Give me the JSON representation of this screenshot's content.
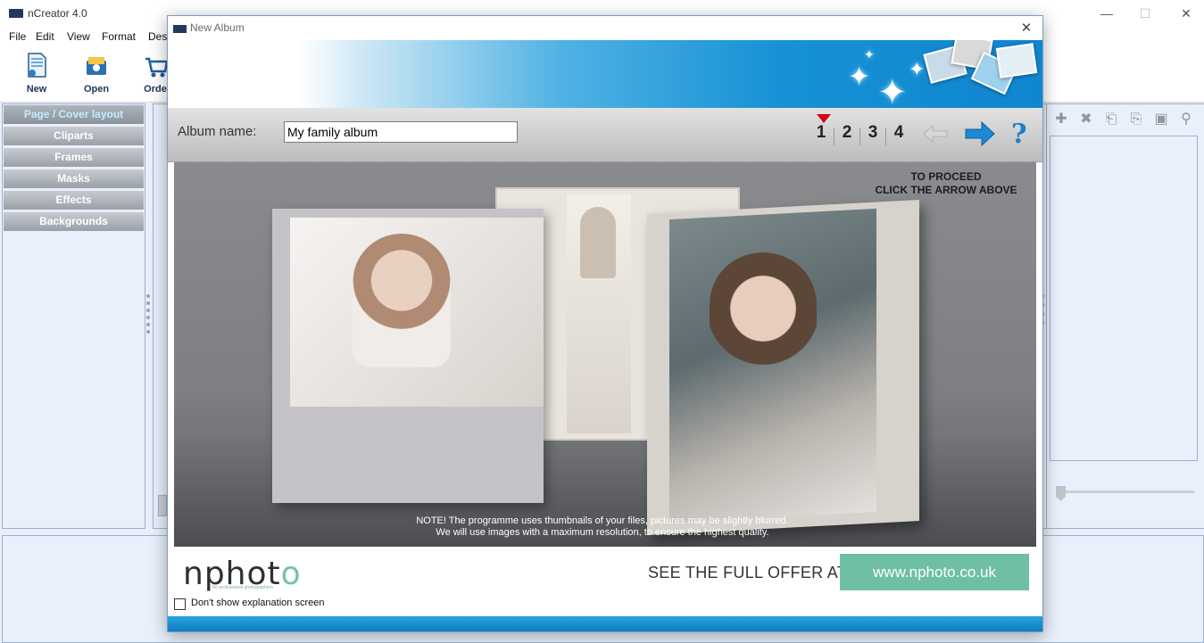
{
  "app": {
    "title": "nCreator 4.0",
    "menu": [
      "File",
      "Edit",
      "View",
      "Format",
      "Desi"
    ],
    "toolbar": [
      {
        "label": "New",
        "icon": "new-document-icon"
      },
      {
        "label": "Open",
        "icon": "open-folder-icon"
      },
      {
        "label": "Orde",
        "icon": "shopping-cart-icon"
      }
    ],
    "window_controls": {
      "minimize": "—",
      "maximize": "☐",
      "close": "✕"
    }
  },
  "left_panel": {
    "tabs": [
      "Page / Cover layout",
      "Cliparts",
      "Frames",
      "Masks",
      "Effects",
      "Backgrounds"
    ],
    "active_tab": "Page / Cover layout"
  },
  "right_panel": {
    "icons": [
      "add-icon",
      "delete-icon",
      "import-icon",
      "export-icon",
      "camera-icon",
      "stamp-icon"
    ]
  },
  "dialog": {
    "title": "New Album",
    "close": "✕",
    "album_name_label": "Album name:",
    "album_name_value": "My family album",
    "steps": [
      "1",
      "2",
      "3",
      "4"
    ],
    "current_step": "1",
    "help": "?",
    "proceed_line1": "TO PROCEED",
    "proceed_line2": "CLICK THE ARROW ABOVE",
    "note_line1": "NOTE! The programme uses thumbnails of your files, pictures may be slightly blurred.",
    "note_line2": "We will use images with a maximum resolution, to ensure the highest quality.",
    "logo_text_main": "nphot",
    "logo_text_accent": "o",
    "logo_tagline": "for professional photographers",
    "offer_text": "SEE THE FULL OFFER AT",
    "url": "www.nphoto.co.uk",
    "dont_show_label": "Don't show explanation screen",
    "colors": {
      "accent_blue": "#1791d6",
      "offer_green": "#6fbfa4",
      "step_marker": "#d0021b"
    }
  }
}
